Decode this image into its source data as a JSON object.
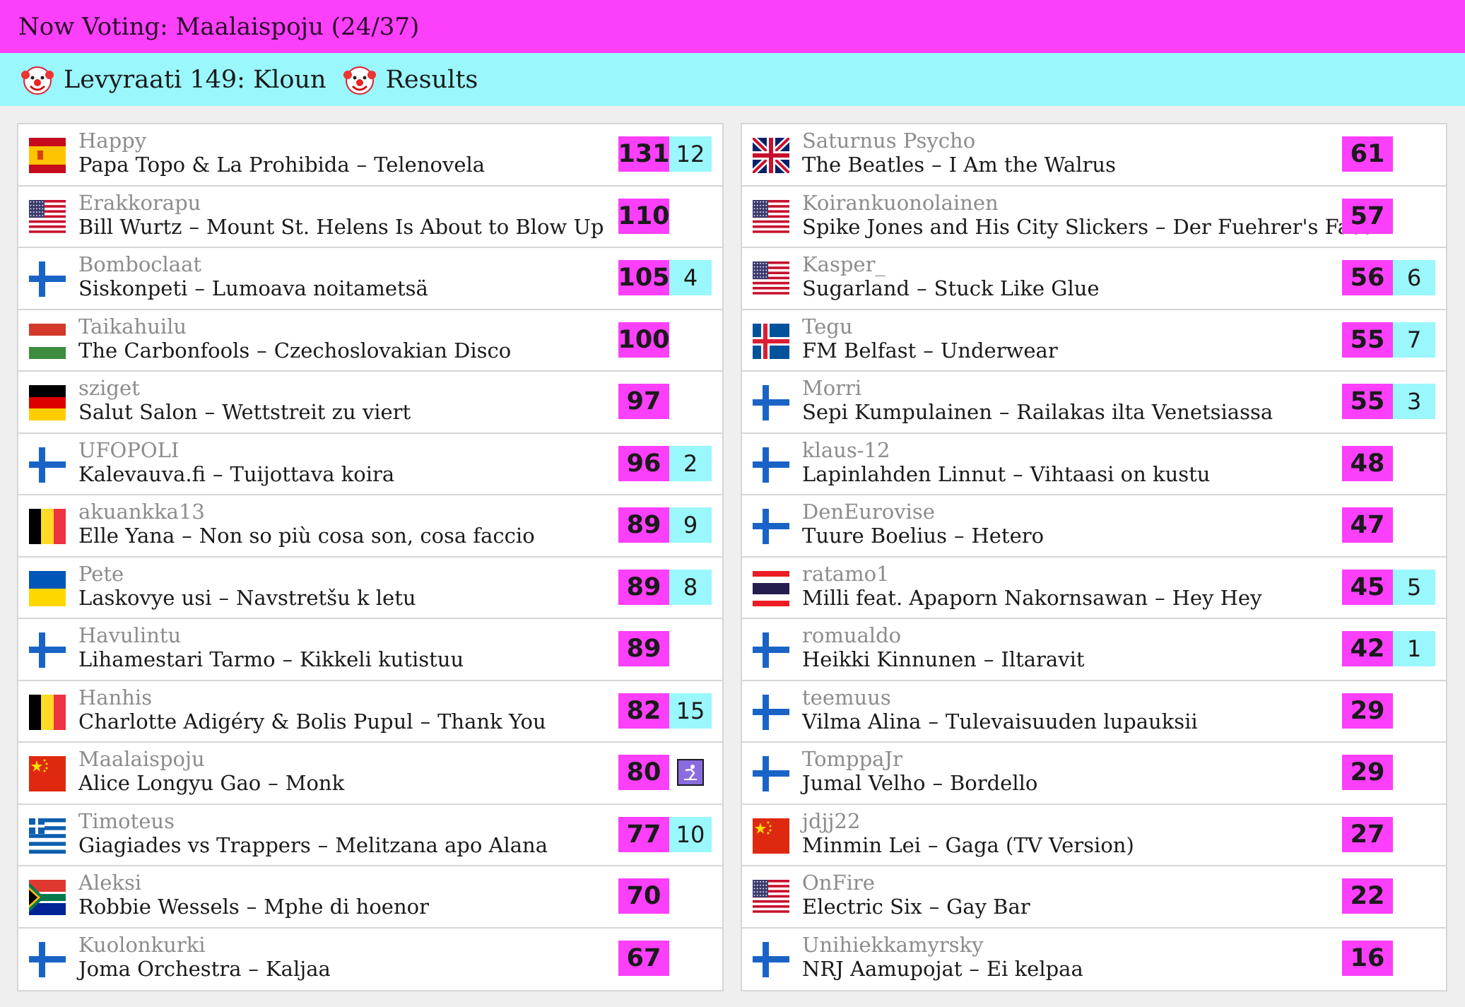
{
  "header": {
    "now_voting": "Now Voting: Maalaispoju (24/37)",
    "round_title": "Levyraati 149: Kloun",
    "results_label": "Results"
  },
  "colors": {
    "score_bg": "#fb3ffb",
    "points_bg": "#9af7fb"
  },
  "icons": {
    "title": "clown-face-icon",
    "current_voter": "user-voting-icon"
  },
  "left_column": [
    {
      "flag": "es",
      "voter": "Happy",
      "artist": "Papa Topo & La Prohibida",
      "title": "Telenovela",
      "score": "131",
      "points": "12"
    },
    {
      "flag": "us",
      "voter": "Erakkorapu",
      "artist": "Bill Wurtz",
      "title": "Mount St. Helens Is About to Blow Up",
      "score": "110",
      "points": ""
    },
    {
      "flag": "fi",
      "voter": "Bomboclaat",
      "artist": "Siskonpeti",
      "title": "Lumoava noitametsä",
      "score": "105",
      "points": "4"
    },
    {
      "flag": "hu",
      "voter": "Taikahuilu",
      "artist": "The Carbonfools",
      "title": "Czechoslovakian Disco",
      "score": "100",
      "points": ""
    },
    {
      "flag": "de",
      "voter": "sziget",
      "artist": "Salut Salon",
      "title": "Wettstreit zu viert",
      "score": "97",
      "points": ""
    },
    {
      "flag": "fi",
      "voter": "UFOPOLI",
      "artist": "Kalevauva.fi",
      "title": "Tuijottava koira",
      "score": "96",
      "points": "2"
    },
    {
      "flag": "be",
      "voter": "akuankka13",
      "artist": "Elle Yana",
      "title": "Non so più cosa son, cosa faccio",
      "score": "89",
      "points": "9"
    },
    {
      "flag": "ua",
      "voter": "Pete",
      "artist": "Laskovye usi",
      "title": "Navstretšu k letu",
      "score": "89",
      "points": "8"
    },
    {
      "flag": "fi",
      "voter": "Havulintu",
      "artist": "Lihamestari Tarmo",
      "title": "Kikkeli kutistuu",
      "score": "89",
      "points": ""
    },
    {
      "flag": "be",
      "voter": "Hanhis",
      "artist": "Charlotte Adigéry & Bolis Pupul",
      "title": "Thank You",
      "score": "82",
      "points": "15"
    },
    {
      "flag": "cn",
      "voter": "Maalaispoju",
      "artist": "Alice Longyu Gao",
      "title": "Monk",
      "score": "80",
      "points": "",
      "current": true
    },
    {
      "flag": "gr",
      "voter": "Timoteus",
      "artist": "Giagiades vs Trappers",
      "title": "Melitzana apo Alana",
      "score": "77",
      "points": "10"
    },
    {
      "flag": "za",
      "voter": "Aleksi",
      "artist": "Robbie Wessels",
      "title": "Mphe di hoenor",
      "score": "70",
      "points": ""
    },
    {
      "flag": "fi",
      "voter": "Kuolonkurki",
      "artist": "Joma Orchestra",
      "title": "Kaljaa",
      "score": "67",
      "points": ""
    }
  ],
  "right_column": [
    {
      "flag": "gb",
      "voter": "Saturnus Psycho",
      "artist": "The Beatles",
      "title": "I Am the Walrus",
      "score": "61",
      "points": ""
    },
    {
      "flag": "us",
      "voter": "Koirankuonolainen",
      "artist": "Spike Jones and His City Slickers",
      "title": "Der Fuehrer's Face",
      "score": "57",
      "points": ""
    },
    {
      "flag": "us",
      "voter": "Kasper_",
      "artist": "Sugarland",
      "title": "Stuck Like Glue",
      "score": "56",
      "points": "6"
    },
    {
      "flag": "is",
      "voter": "Tegu",
      "artist": "FM Belfast",
      "title": "Underwear",
      "score": "55",
      "points": "7"
    },
    {
      "flag": "fi",
      "voter": "Morri",
      "artist": "Sepi Kumpulainen",
      "title": "Railakas ilta Venetsiassa",
      "score": "55",
      "points": "3"
    },
    {
      "flag": "fi",
      "voter": "klaus-12",
      "artist": "Lapinlahden Linnut",
      "title": "Vihtaasi on kustu",
      "score": "48",
      "points": ""
    },
    {
      "flag": "fi",
      "voter": "DenEurovise",
      "artist": "Tuure Boelius",
      "title": "Hetero",
      "score": "47",
      "points": ""
    },
    {
      "flag": "th",
      "voter": "ratamo1",
      "artist": "Milli feat. Apaporn Nakornsawan",
      "title": "Hey Hey",
      "score": "45",
      "points": "5"
    },
    {
      "flag": "fi",
      "voter": "romualdo",
      "artist": "Heikki Kinnunen",
      "title": "Iltaravit",
      "score": "42",
      "points": "1"
    },
    {
      "flag": "fi",
      "voter": "teemuus",
      "artist": "Vilma Alina",
      "title": "Tulevaisuuden lupauksii",
      "score": "29",
      "points": ""
    },
    {
      "flag": "fi",
      "voter": "TomppaJr",
      "artist": "Jumal Velho",
      "title": "Bordello",
      "score": "29",
      "points": ""
    },
    {
      "flag": "cn",
      "voter": "jdjj22",
      "artist": "Minmin Lei",
      "title": "Gaga (TV Version)",
      "score": "27",
      "points": ""
    },
    {
      "flag": "us",
      "voter": "OnFire",
      "artist": "Electric Six",
      "title": "Gay Bar",
      "score": "22",
      "points": ""
    },
    {
      "flag": "fi",
      "voter": "Unihiekkamyrsky",
      "artist": "NRJ Aamupojat",
      "title": "Ei kelpaa",
      "score": "16",
      "points": ""
    }
  ]
}
